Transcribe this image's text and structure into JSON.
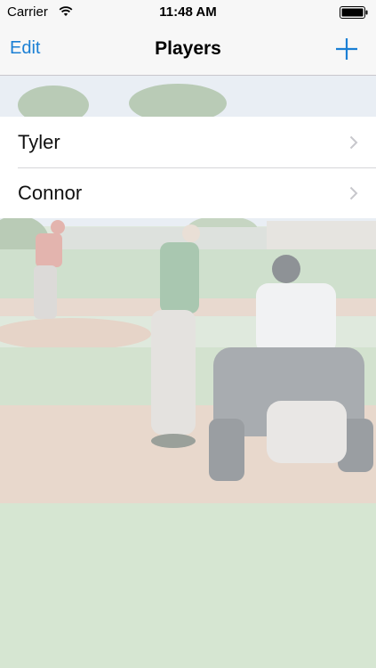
{
  "status_bar": {
    "carrier": "Carrier",
    "time": "11:48 AM",
    "wifi_icon": "wifi-icon",
    "battery_icon": "battery-icon"
  },
  "nav_bar": {
    "edit_label": "Edit",
    "title": "Players",
    "add_icon": "plus-icon"
  },
  "players": [
    {
      "name": "Tyler",
      "icon": "chevron-right-icon"
    },
    {
      "name": "Connor",
      "icon": "chevron-right-icon"
    }
  ],
  "colors": {
    "accent": "#1a7fd4",
    "bar_background": "#f7f7f7"
  }
}
